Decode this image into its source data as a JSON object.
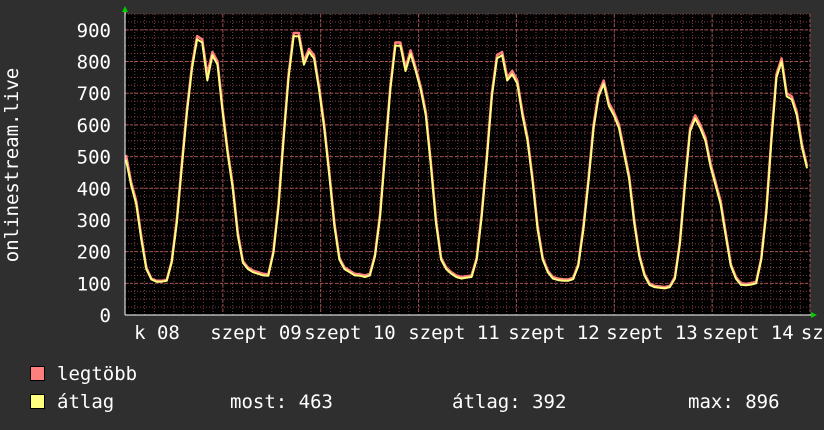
{
  "chart_data": {
    "type": "area",
    "ylabel": "onlinestream.live",
    "ylim": [
      0,
      950
    ],
    "y_ticks": [
      0,
      100,
      200,
      300,
      400,
      500,
      600,
      700,
      800,
      900
    ],
    "x_tick_labels": [
      "k 08",
      "szept 09",
      "szept 10",
      "szept 11",
      "szept 12",
      "szept 13",
      "szept 14",
      "sze"
    ],
    "grid": true,
    "colors": {
      "max": "#ff7f7f",
      "avg": "#ffff7f",
      "grid": "#7f4040",
      "axis": "#ffffff",
      "arrow": "#00cc00"
    },
    "series": [
      {
        "name": "legtöbb",
        "values": [
          505,
          420,
          360,
          250,
          150,
          115,
          108,
          108,
          110,
          170,
          300,
          480,
          650,
          790,
          880,
          870,
          760,
          830,
          800,
          650,
          520,
          410,
          260,
          170,
          150,
          140,
          135,
          130,
          128,
          200,
          350,
          560,
          760,
          890,
          890,
          800,
          840,
          820,
          720,
          600,
          450,
          290,
          180,
          150,
          140,
          130,
          128,
          125,
          130,
          190,
          320,
          520,
          720,
          860,
          860,
          780,
          835,
          780,
          720,
          640,
          480,
          300,
          180,
          150,
          135,
          125,
          120,
          122,
          125,
          180,
          320,
          500,
          700,
          820,
          830,
          750,
          770,
          740,
          640,
          560,
          430,
          280,
          180,
          140,
          120,
          115,
          113,
          112,
          118,
          160,
          280,
          430,
          600,
          700,
          740,
          670,
          640,
          600,
          520,
          440,
          300,
          190,
          130,
          100,
          92,
          90,
          88,
          92,
          120,
          230,
          420,
          590,
          630,
          600,
          560,
          480,
          420,
          360,
          260,
          160,
          120,
          100,
          98,
          100,
          105,
          180,
          330,
          560,
          760,
          810,
          700,
          690,
          640,
          540,
          470
        ]
      },
      {
        "name": "átlag",
        "values": [
          490,
          410,
          350,
          240,
          145,
          112,
          105,
          105,
          108,
          165,
          290,
          470,
          640,
          780,
          870,
          860,
          740,
          820,
          790,
          640,
          510,
          400,
          250,
          165,
          145,
          135,
          130,
          125,
          124,
          195,
          340,
          550,
          750,
          880,
          880,
          790,
          830,
          810,
          710,
          590,
          440,
          280,
          175,
          145,
          135,
          125,
          124,
          120,
          125,
          185,
          310,
          510,
          710,
          850,
          850,
          770,
          825,
          770,
          710,
          630,
          470,
          290,
          175,
          145,
          130,
          120,
          115,
          118,
          120,
          175,
          310,
          490,
          690,
          810,
          820,
          740,
          760,
          730,
          630,
          550,
          420,
          270,
          175,
          135,
          115,
          110,
          108,
          108,
          113,
          155,
          270,
          420,
          590,
          690,
          730,
          660,
          630,
          590,
          510,
          430,
          290,
          185,
          125,
          95,
          88,
          86,
          84,
          88,
          115,
          225,
          410,
          580,
          620,
          590,
          550,
          470,
          410,
          350,
          250,
          155,
          115,
          95,
          94,
          96,
          100,
          175,
          320,
          550,
          750,
          800,
          690,
          680,
          630,
          530,
          463
        ]
      }
    ],
    "stats": {
      "current": 463,
      "average": 392,
      "max": 896
    }
  },
  "legend": {
    "max_label": "legtöbb",
    "avg_label": "átlag",
    "current_label": "most: 463",
    "average_label": "átlag: 392",
    "maximum_label": "max: 896"
  }
}
